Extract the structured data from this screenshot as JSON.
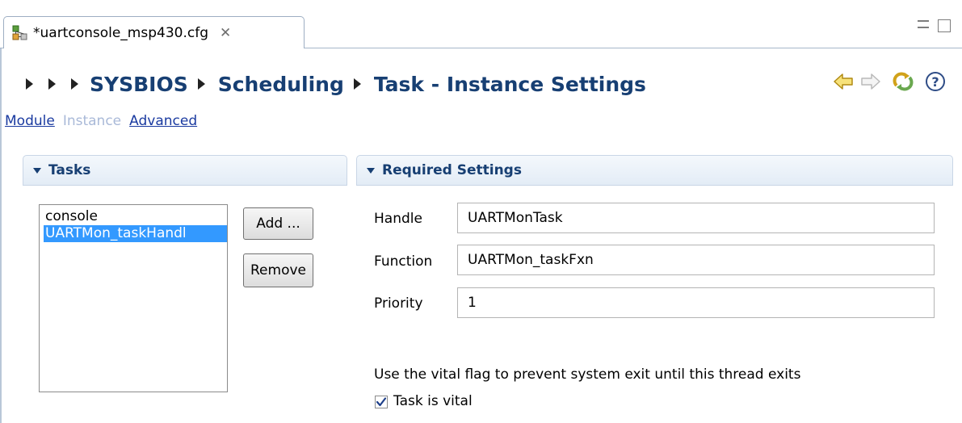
{
  "editor_tab": {
    "title": "*uartconsole_msp430.cfg",
    "close_glyph": "✕"
  },
  "breadcrumb": {
    "items": [
      "SYSBIOS",
      "Scheduling",
      "Task - Instance Settings"
    ]
  },
  "toolbar": {
    "help_glyph": "?"
  },
  "links": {
    "module": "Module",
    "instance": "Instance",
    "advanced": "Advanced"
  },
  "tasks_section": {
    "title": "Tasks",
    "items": [
      {
        "label": "console",
        "selected": false
      },
      {
        "label": "UARTMon_taskHandl",
        "selected": true
      }
    ],
    "add_label": "Add ...",
    "remove_label": "Remove"
  },
  "required_settings": {
    "title": "Required Settings",
    "handle_label": "Handle",
    "handle_value": "UARTMonTask",
    "function_label": "Function",
    "function_value": "UARTMon_taskFxn",
    "priority_label": "Priority",
    "priority_value": "1",
    "vital_description": "Use the vital flag to prevent system exit until this thread exits",
    "vital_label": "Task is vital",
    "vital_checked": true
  },
  "icons": {
    "tab": "config-file-icon",
    "back": "back-arrow-icon",
    "forward": "forward-arrow-icon",
    "refresh": "refresh-icon",
    "help": "help-icon"
  },
  "colors": {
    "heading": "#173f73",
    "link": "#1a3aa0",
    "disabled_link": "#a9b9d8",
    "selection": "#3399ff"
  }
}
